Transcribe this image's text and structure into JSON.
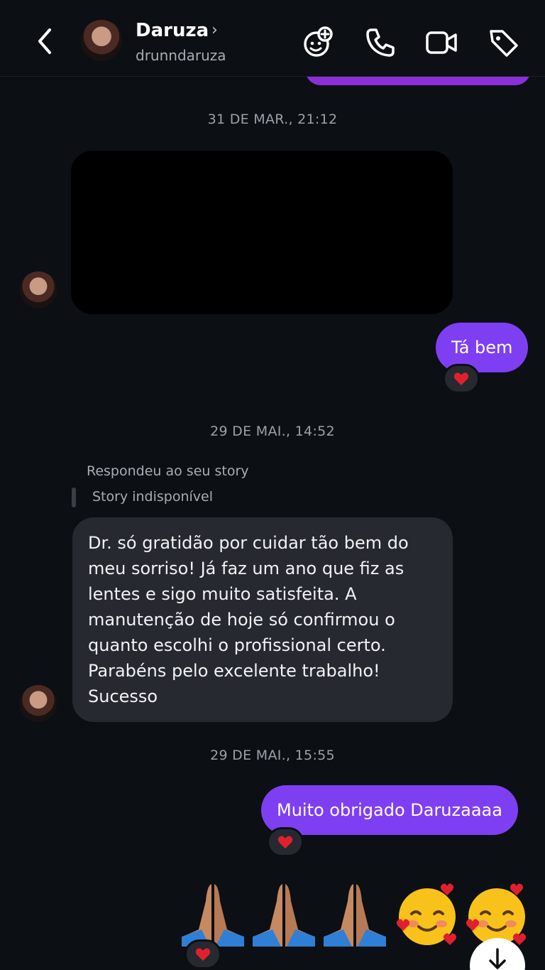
{
  "header": {
    "name": "Daruza",
    "name_chevron": "›",
    "handle": "drunndaruza",
    "icons": [
      "back-icon",
      "add-participant-icon",
      "phone-icon",
      "video-icon",
      "tag-icon"
    ]
  },
  "thread": {
    "timestamps": [
      "31 DE MAR., 21:12",
      "29 DE MAI., 14:52",
      "29 DE MAI., 15:55"
    ],
    "outgoing_1": "Tá bem",
    "reply_label": "Respondeu ao seu story",
    "reply_story": "Story indisponível",
    "incoming_lines": [
      "Dr. só gratidão por cuidar tão bem do",
      "meu sorriso! Já faz um ano que fiz as",
      "lentes e sigo muito satisfeita. A",
      "manutenção de hoje só confirmou o",
      "quanto escolhi o profissional certo.",
      "Parabéns pelo excelente trabalho!",
      "Sucesso"
    ],
    "outgoing_2": "Muito obrigado Daruzaaaa",
    "emoji_message": "🙏🙏🙏🥰🥰",
    "reaction": "heart-reaction"
  },
  "colors": {
    "background": "#0c0f14",
    "outgoing_bubble": "#7e3ff2",
    "incoming_bubble": "#262930",
    "muted_text": "#9ca1a9",
    "heart": "#e0202f"
  }
}
